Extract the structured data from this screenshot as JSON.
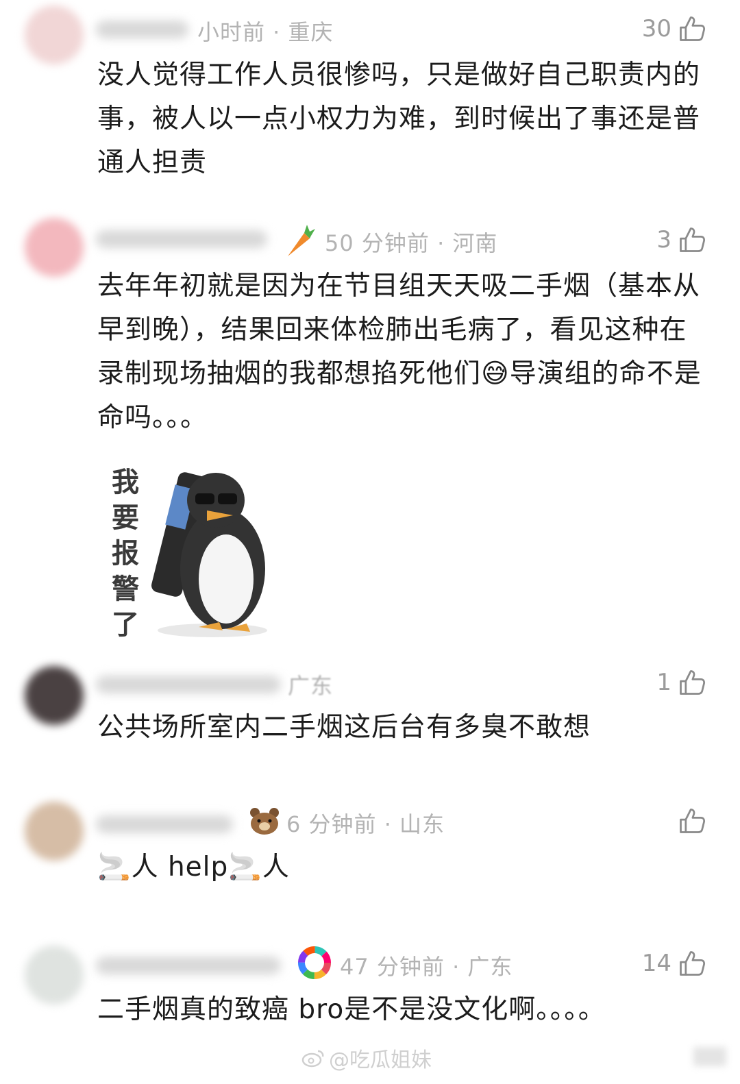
{
  "comments": [
    {
      "meta": "小时前 · 重庆",
      "likes": "30",
      "text": "没人觉得工作人员很惨吗，只是做好自己职责内的事，被人以一点小权力为难，到时候出了事还是普通人担责"
    },
    {
      "meta": "50 分钟前 · 河南",
      "likes": "3",
      "badge_icon": "carrot-icon",
      "text_before_emoji": "去年年初就是因为在节目组天天吸二手烟（基本从早到晚），结果回来体检肺出毛病了，看见这种在录制现场抽烟的我都想掐死他们",
      "emoji": "😅",
      "text_after_emoji": "导演组的命不是命吗。。。",
      "sticker_text": "我要报警了"
    },
    {
      "meta": "广东",
      "likes": "1",
      "text": "公共场所室内二手烟这后台有多臭不敢想"
    },
    {
      "meta": "6 分钟前 · 山东",
      "likes": "",
      "badge_icon": "bear-icon",
      "text_parts": [
        "🚬",
        "人 help",
        "🚬",
        "人"
      ]
    },
    {
      "meta": "47 分钟前 · 广东",
      "likes": "14",
      "badge_icon": "colorful-ring-icon",
      "text": "二手烟真的致癌 bro是不是没文化啊。。。。"
    }
  ],
  "watermark": "@吃瓜姐妹",
  "colors": {
    "meta_gray": "#b3b3b3",
    "text": "#1c1c1c",
    "like_gray": "#9b9b9b"
  }
}
